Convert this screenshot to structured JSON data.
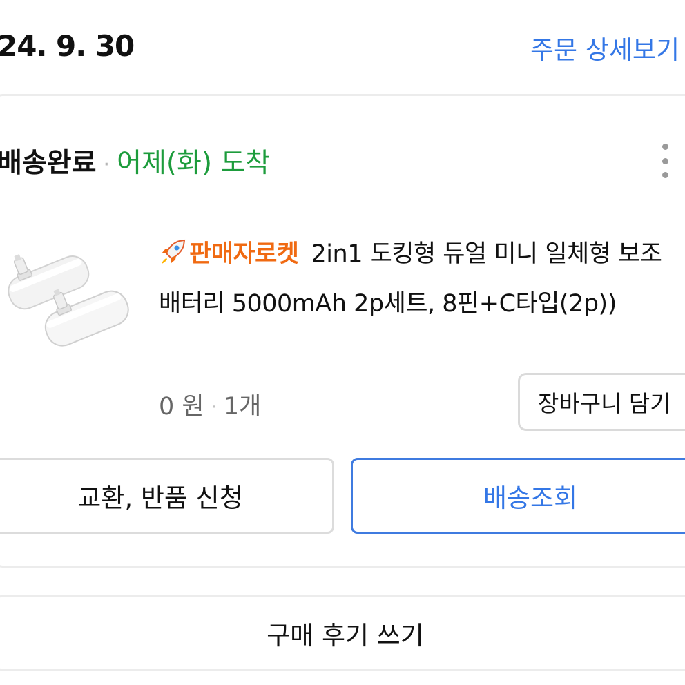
{
  "order": {
    "date": "24. 9. 30",
    "detail_link": "주문 상세보기"
  },
  "shipment": {
    "status": "배송완료",
    "separator": "·",
    "arrival": "어제(화) 도착",
    "menu_icon": "more-vertical-icon"
  },
  "product": {
    "image": "mini-power-bank-product-image",
    "badge_icon": "rocket-icon",
    "badge_label": "판매자로켓",
    "name": "2in1 도킹형 듀얼 미니 일체형 보조배터리 5000mAh 2p세트, 8핀+C타입(2p))",
    "price": "0 원",
    "separator": "·",
    "quantity": "1개",
    "cart_button": "장바구니 담기"
  },
  "actions": {
    "exchange_return": "교환, 반품 신청",
    "track_delivery": "배송조회",
    "write_review": "구매 후기 쓰기"
  },
  "colors": {
    "link_blue": "#3477e6",
    "arrival_green": "#1d9c3c",
    "rocket_orange": "#f06a12"
  }
}
